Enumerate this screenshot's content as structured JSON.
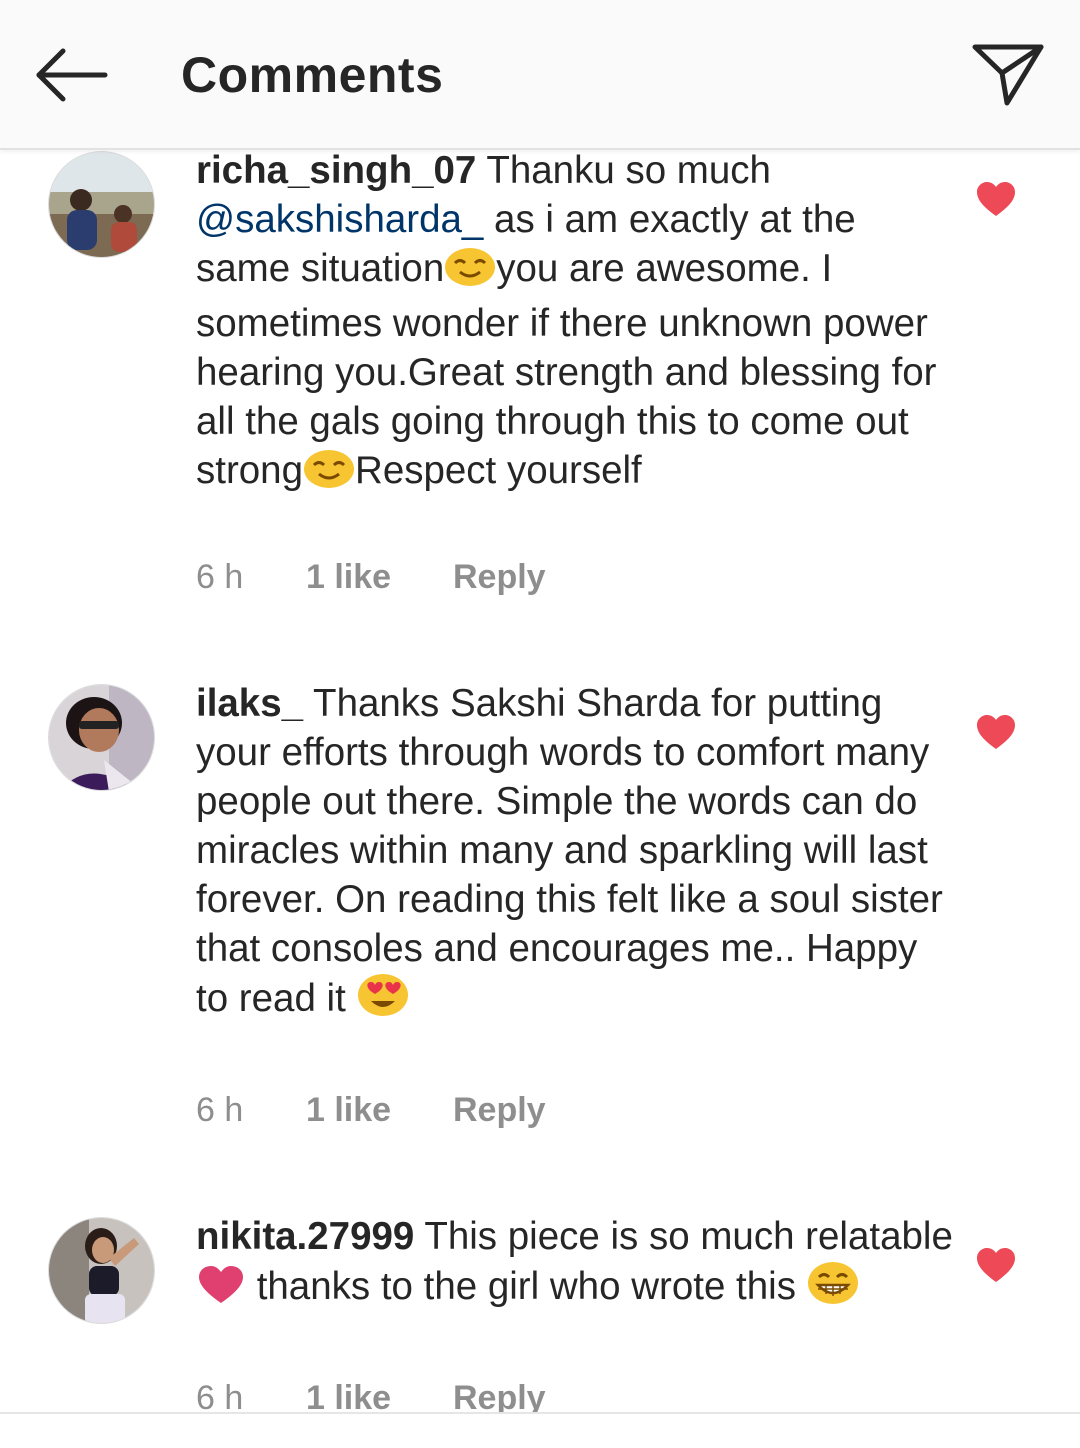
{
  "header": {
    "title": "Comments",
    "back_icon": "arrow-left-icon",
    "send_icon": "direct-send-icon"
  },
  "colors": {
    "accent_link": "#003569",
    "heart": "#ed4956",
    "meta_text": "#8e8e8e",
    "text": "#262626"
  },
  "comments": [
    {
      "username": "richa_singh_07",
      "text_parts": [
        " Thanku so much ",
        "@sakshisharda_",
        "  as i am exactly at the same situation",
        "you are awesome. I sometimes wonder if there unknown power hearing you.Great strength and blessing for all the gals going through this to come out strong",
        "Respect yourself"
      ],
      "emojis": [
        "smiling-face-emoji",
        "smiling-face-emoji"
      ],
      "time": "6 h",
      "likes": "1 like",
      "reply": "Reply",
      "liked": true
    },
    {
      "username": "ilaks_",
      "text_parts": [
        " Thanks Sakshi Sharda for putting your efforts through words to comfort many people out there. Simple the words can do miracles within many and sparkling will last forever. On reading this felt like a soul sister that consoles and encourages me.. Happy to read it "
      ],
      "emojis": [
        "heart-eyes-emoji"
      ],
      "time": "6 h",
      "likes": "1 like",
      "reply": "Reply",
      "liked": true
    },
    {
      "username": "nikita.27999",
      "text_parts": [
        " This piece is so much relatable",
        " thanks to the girl who wrote this "
      ],
      "emojis": [
        "pink-heart-emoji",
        "grinning-face-emoji"
      ],
      "time": "6 h",
      "likes": "1 like",
      "reply": "Reply",
      "liked": true
    }
  ]
}
